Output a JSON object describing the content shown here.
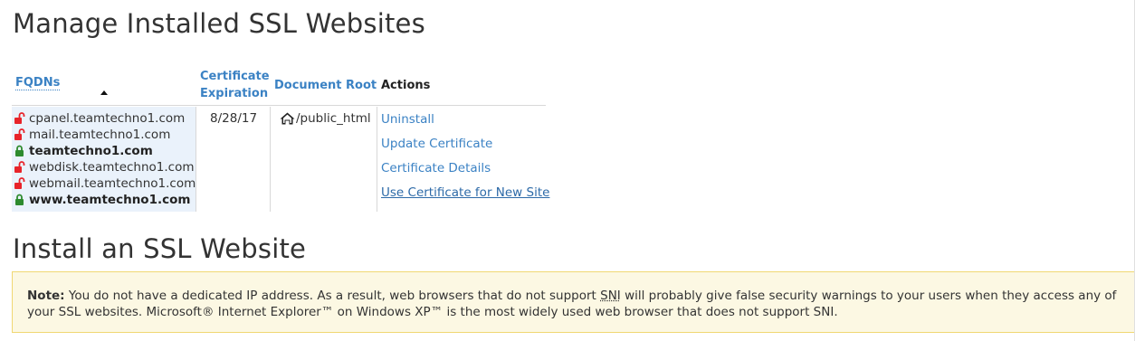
{
  "manage_title": "Manage Installed SSL Websites",
  "install_title": "Install an SSL Website",
  "table": {
    "headers": {
      "fqdns": "FQDNs",
      "cert_expiration_line1": "Certificate",
      "cert_expiration_line2": "Expiration",
      "document_root": "Document Root",
      "actions": "Actions"
    },
    "row": {
      "fqdns": [
        {
          "name": "cpanel.teamtechno1.com",
          "secure": false
        },
        {
          "name": "mail.teamtechno1.com",
          "secure": false
        },
        {
          "name": "teamtechno1.com",
          "secure": true
        },
        {
          "name": "webdisk.teamtechno1.com",
          "secure": false
        },
        {
          "name": "webmail.teamtechno1.com",
          "secure": false
        },
        {
          "name": "www.teamtechno1.com",
          "secure": true
        }
      ],
      "expiration": "8/28/17",
      "document_root": "/public_html",
      "actions": {
        "uninstall": "Uninstall",
        "update": "Update Certificate",
        "details": "Certificate Details",
        "use_new_site": "Use Certificate for New Site"
      }
    }
  },
  "note": {
    "label": "Note:",
    "text_part1": " You do not have a dedicated IP address. As a result, web browsers that do not support ",
    "sni": "SNI",
    "text_part2": " will probably give false security warnings to your users when they access any of your SSL websites. Microsoft® Internet Explorer™ on Windows XP™ is the most widely used web browser that does not support SNI."
  },
  "colors": {
    "link": "#3b82c4",
    "lock_open": "#e8232a",
    "lock_closed": "#2e8b2e",
    "note_bg": "#fcf8e3",
    "fqdn_bg": "#eaf2fb"
  }
}
